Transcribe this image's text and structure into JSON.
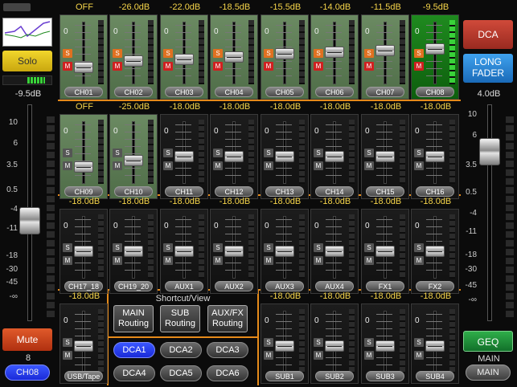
{
  "left_panel": {
    "solo_label": "Solo",
    "level": "-9.5dB",
    "scale": [
      "10",
      "6",
      "3.5",
      "0.5",
      "-4",
      "-11",
      "-18",
      "-30",
      "-45",
      "-∞"
    ],
    "mute_label": "Mute",
    "channel_number": "8",
    "channel_label": "CH08"
  },
  "right_panel": {
    "dca_label": "DCA",
    "long_fader_label": "LONG FADER",
    "level": "4.0dB",
    "scale": [
      "10",
      "6",
      "3.5",
      "0.5",
      "-4",
      "-11",
      "-18",
      "-30",
      "-45",
      "-∞"
    ],
    "geq_label": "GEQ",
    "main_text": "MAIN",
    "main_button": "MAIN"
  },
  "row1": [
    {
      "db": "OFF",
      "name": "CH01",
      "solo": true,
      "mute": true,
      "fader": 0.78,
      "style": "green"
    },
    {
      "db": "-26.0dB",
      "name": "CH02",
      "solo": true,
      "mute": true,
      "fader": 0.66,
      "style": "green"
    },
    {
      "db": "-22.0dB",
      "name": "CH03",
      "solo": true,
      "mute": true,
      "fader": 0.62,
      "style": "green"
    },
    {
      "db": "-18.5dB",
      "name": "CH04",
      "solo": true,
      "mute": true,
      "fader": 0.58,
      "style": "green"
    },
    {
      "db": "-15.5dB",
      "name": "CH05",
      "solo": true,
      "mute": true,
      "fader": 0.52,
      "style": "green"
    },
    {
      "db": "-14.0dB",
      "name": "CH06",
      "solo": true,
      "mute": true,
      "fader": 0.48,
      "style": "green"
    },
    {
      "db": "-11.5dB",
      "name": "CH07",
      "solo": true,
      "mute": true,
      "fader": 0.46,
      "style": "green"
    },
    {
      "db": "-9.5dB",
      "name": "CH08",
      "solo": true,
      "mute": true,
      "fader": 0.42,
      "style": "bright"
    }
  ],
  "row2": [
    {
      "db": "OFF",
      "name": "CH09",
      "solo": false,
      "mute": false,
      "fader": 0.78,
      "style": "green"
    },
    {
      "db": "-25.0dB",
      "name": "CH10",
      "solo": false,
      "mute": false,
      "fader": 0.66,
      "style": "green"
    },
    {
      "db": "-18.0dB",
      "name": "CH11",
      "solo": false,
      "mute": false,
      "fader": 0.58,
      "style": "dark"
    },
    {
      "db": "-18.0dB",
      "name": "CH12",
      "solo": false,
      "mute": false,
      "fader": 0.58,
      "style": "dark"
    },
    {
      "db": "-18.0dB",
      "name": "CH13",
      "solo": false,
      "mute": false,
      "fader": 0.58,
      "style": "dark"
    },
    {
      "db": "-18.0dB",
      "name": "CH14",
      "solo": false,
      "mute": false,
      "fader": 0.58,
      "style": "dark"
    },
    {
      "db": "-18.0dB",
      "name": "CH15",
      "solo": false,
      "mute": false,
      "fader": 0.58,
      "style": "dark"
    },
    {
      "db": "-18.0dB",
      "name": "CH16",
      "solo": false,
      "mute": false,
      "fader": 0.58,
      "style": "dark"
    }
  ],
  "row3": [
    {
      "db": "-18.0dB",
      "name": "CH17_18",
      "solo": false,
      "mute": false,
      "fader": 0.58,
      "style": "dark"
    },
    {
      "db": "-18.0dB",
      "name": "CH19_20",
      "solo": false,
      "mute": false,
      "fader": 0.58,
      "style": "dark"
    },
    {
      "db": "-18.0dB",
      "name": "AUX1",
      "solo": false,
      "mute": false,
      "fader": 0.58,
      "style": "dark"
    },
    {
      "db": "-18.0dB",
      "name": "AUX2",
      "solo": false,
      "mute": false,
      "fader": 0.58,
      "style": "dark"
    },
    {
      "db": "-18.0dB",
      "name": "AUX3",
      "solo": false,
      "mute": false,
      "fader": 0.58,
      "style": "dark"
    },
    {
      "db": "-18.0dB",
      "name": "AUX4",
      "solo": false,
      "mute": false,
      "fader": 0.58,
      "style": "dark"
    },
    {
      "db": "-18.0dB",
      "name": "FX1",
      "solo": false,
      "mute": false,
      "fader": 0.58,
      "style": "dark"
    },
    {
      "db": "-18.0dB",
      "name": "FX2",
      "solo": false,
      "mute": false,
      "fader": 0.58,
      "style": "dark"
    }
  ],
  "row4": [
    {
      "db": "-18.0dB",
      "name": "USB/Tape",
      "solo": false,
      "mute": false,
      "fader": 0.58,
      "style": "dark"
    },
    {
      "db": "-18.0dB",
      "name": "SUB1",
      "solo": false,
      "mute": false,
      "fader": 0.58,
      "style": "dark"
    },
    {
      "db": "-18.0dB",
      "name": "SUB2",
      "solo": false,
      "mute": false,
      "fader": 0.58,
      "style": "dark"
    },
    {
      "db": "-18.0dB",
      "name": "SUB3",
      "solo": false,
      "mute": false,
      "fader": 0.58,
      "style": "dark"
    },
    {
      "db": "-18.0dB",
      "name": "SUB4",
      "solo": false,
      "mute": false,
      "fader": 0.58,
      "style": "dark"
    }
  ],
  "shortcut": {
    "title": "Shortcut/View",
    "routing": [
      {
        "line1": "MAIN",
        "line2": "Routing"
      },
      {
        "line1": "SUB",
        "line2": "Routing"
      },
      {
        "line1": "AUX/FX",
        "line2": "Routing"
      }
    ],
    "dca": [
      "DCA1",
      "DCA2",
      "DCA3",
      "DCA4",
      "DCA5",
      "DCA6"
    ],
    "dca_selected": "DCA1"
  },
  "fader_zero": "0",
  "solo_letter": "S",
  "mute_letter": "M",
  "colors": {
    "accent_orange": "#e58a1a",
    "db_yellow": "#f5d44a",
    "solo_orange": "#e07020",
    "mute_red": "#d02020",
    "dca_red": "#c0392b",
    "long_fader_blue": "#2a8ad8",
    "geq_green": "#1f9a3a",
    "selected_blue": "#1a2ad8"
  }
}
